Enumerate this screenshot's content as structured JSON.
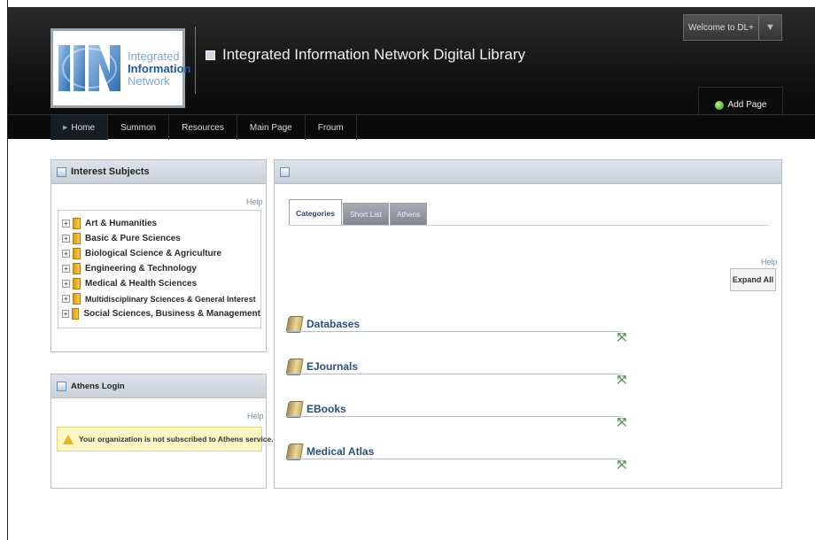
{
  "header": {
    "logo": {
      "letters": "IIN",
      "line1": "Integrated",
      "line2": "Information",
      "line3": "Network"
    },
    "site_title": "Integrated Information Network Digital Library",
    "welcome": "Welcome to DL+",
    "welcome_dropdown_icon": "chevron-down-icon",
    "add_page": "Add Page"
  },
  "nav": {
    "items": [
      {
        "label": "Home",
        "active": true
      },
      {
        "label": "Summon"
      },
      {
        "label": "Resources"
      },
      {
        "label": "Main Page"
      },
      {
        "label": "Froum"
      }
    ]
  },
  "interest_subjects": {
    "title": "Interest Subjects",
    "help": "Help",
    "items": [
      "Art & Humanities",
      "Basic & Pure Sciences",
      "Biological Science & Agriculture",
      "Engineering & Technology",
      "Medical & Health Sciences",
      "Multidisciplinary Sciences & General Interest",
      "Social Sciences, Business & Management"
    ]
  },
  "athens_login": {
    "title": "Athens Login",
    "help": "Help",
    "warning": "Your organization is not subscribed to Athens service."
  },
  "main_panel": {
    "tabs": [
      {
        "label": "Categories",
        "active": true
      },
      {
        "label": "Short List"
      },
      {
        "label": "Athens"
      }
    ],
    "help": "Help",
    "expand_all": "Expand All",
    "categories": [
      "Databases",
      "EJournals",
      "EBooks",
      "Medical Atlas"
    ]
  },
  "colors": {
    "header_bg": "#101010",
    "nav_bg": "#0a0a0a",
    "link_blue": "#2c4f7c",
    "warning_bg": "#fbf7c5",
    "panel_head": "#d3dae2"
  }
}
